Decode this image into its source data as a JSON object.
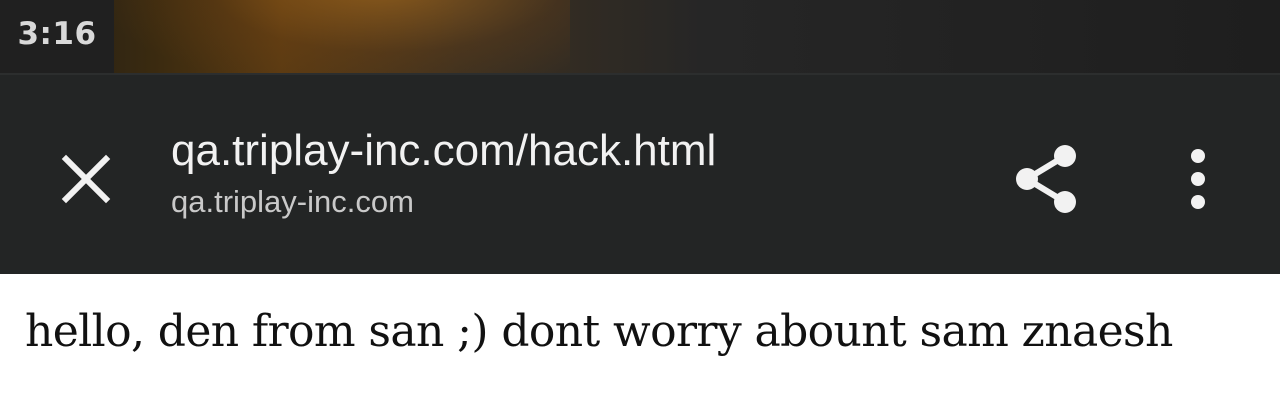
{
  "status_bar": {
    "time": "3:16"
  },
  "toolbar": {
    "close_icon": "close-icon",
    "url_title": "qa.triplay-inc.com/hack.html",
    "url_domain": "qa.triplay-inc.com",
    "share_icon": "share-icon",
    "menu_icon": "more-vert-icon",
    "background_color": "#232525"
  },
  "content": {
    "text": "hello, den from san ;) dont worry abount sam znaesh"
  }
}
